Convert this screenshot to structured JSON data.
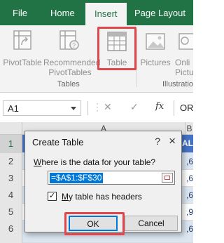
{
  "tabs": {
    "file": "File",
    "home": "Home",
    "insert": "Insert",
    "page_layout": "Page Layout"
  },
  "ribbon": {
    "pivottable": "PivotTable",
    "recommended_line1": "Recommended",
    "recommended_line2": "PivotTables",
    "table": "Table",
    "pictures": "Pictures",
    "online_line1": "Onli",
    "online_line2": "Pictu",
    "group_tables": "Tables",
    "group_illustrations": "Illustratio"
  },
  "formula_bar": {
    "name_box": "A1",
    "fx": "fx",
    "content": "OR"
  },
  "grid": {
    "columns": [
      "A",
      "B"
    ],
    "rows": [
      "1",
      "2",
      "3",
      "4",
      "5",
      "6"
    ],
    "peeks": [
      "AL",
      ",6",
      ",6",
      ",6",
      ",9",
      ",6"
    ]
  },
  "dialog": {
    "title": "Create Table",
    "help": "?",
    "close": "×",
    "prompt_w": "W",
    "prompt_rest": "here is the data for your table?",
    "range_value": "=$A$1:$F$30",
    "has_headers_m": "M",
    "has_headers_rest": "y table has headers",
    "ok": "OK",
    "cancel": "Cancel"
  },
  "colors": {
    "excel_green": "#217346",
    "table_header_blue": "#4472c4",
    "band_blue": "#dce6f1",
    "highlight_red": "#e0474c",
    "selection_blue": "#0078d7"
  }
}
